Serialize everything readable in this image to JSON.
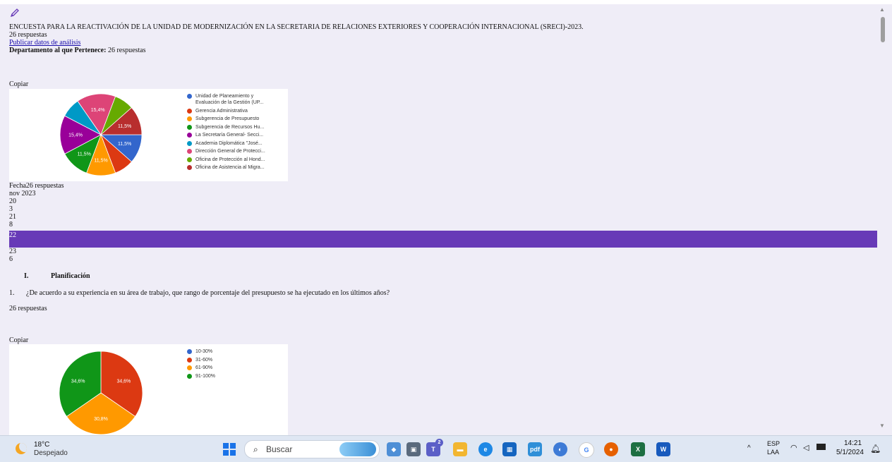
{
  "survey": {
    "title": "ENCUESTA PARA LA REACTIVACIÓN DE LA UNIDAD DE MODERNIZACIÓN EN LA SECRETARIA DE RELACIONES EXTERIORES Y COOPERACIÓN INTERNACIONAL (SRECI)-2023.",
    "responses": "26 respuestas",
    "publish_link": "Publicar datos de análisis"
  },
  "q_department": {
    "label": "Departamento al que Pertenece:",
    "responses": "26 respuestas",
    "copy": "Copiar"
  },
  "q_date": {
    "label": "Fecha",
    "responses": "26 respuestas",
    "month": "nov 2023",
    "values": [
      "20",
      "3",
      "21",
      "8",
      "22",
      "23",
      "6"
    ]
  },
  "section": {
    "number": "I.",
    "title": "Planificación"
  },
  "q_budget": {
    "number": "1.",
    "text": "¿De acuerdo a su experiencia en su área de trabajo, que rango de porcentaje del presupuesto se ha ejecutado en los últimos años?",
    "responses": "26 respuestas",
    "copy": "Copiar"
  },
  "chart_data": [
    {
      "type": "pie",
      "title": "",
      "categories": [
        "Unidad de Planeamiento y Evaluación de la Gestión (UP...",
        "Gerencia Administrativa",
        "Subgerencia de Presupuesto",
        "Subgerencia de Recursos Hu...",
        "La Secretaría General- Secci...",
        "Academia Diplomática \"José...",
        "Dirección General de Protecci...",
        "Oficina de Protección al Hond...",
        "Oficina de Asistencia al Migra..."
      ],
      "legend_lines": [
        [
          "Unidad de Planeamiento y",
          "Evaluación de la Gestión (UP..."
        ],
        [
          "Gerencia Administrativa"
        ],
        [
          "Subgerencia de Presupuesto"
        ],
        [
          "Subgerencia de Recursos Hu..."
        ],
        [
          "La Secretaría General- Secci..."
        ],
        [
          "Academia Diplomática \"José..."
        ],
        [
          "Dirección General de Protecci..."
        ],
        [
          "Oficina de Protección al Hond..."
        ],
        [
          "Oficina de Asistencia al Migra..."
        ]
      ],
      "values": [
        11.5,
        7.7,
        11.5,
        11.5,
        15.4,
        7.7,
        15.4,
        7.7,
        11.5
      ],
      "data_labels": [
        "11,5%",
        "",
        "11,5%",
        "11,5%",
        "15,4%",
        "",
        "15,4%",
        "",
        "11,5%"
      ],
      "colors": [
        "#3366cc",
        "#dc3912",
        "#ff9900",
        "#109618",
        "#990099",
        "#0099c6",
        "#dd4477",
        "#66aa00",
        "#b82e2e"
      ],
      "legend_position": "right"
    },
    {
      "type": "pie",
      "title": "",
      "categories": [
        "10-30%",
        "31-60%",
        "61-90%",
        "91-100%"
      ],
      "legend_lines": [
        [
          "10-30%"
        ],
        [
          "31-60%"
        ],
        [
          "61-90%"
        ],
        [
          "91-100%"
        ]
      ],
      "values": [
        0,
        34.6,
        30.8,
        34.6
      ],
      "data_labels": [
        "",
        "34,6%",
        "30,8%",
        "34,6%"
      ],
      "colors": [
        "#3366cc",
        "#dc3912",
        "#ff9900",
        "#109618"
      ],
      "legend_position": "right"
    }
  ],
  "taskbar": {
    "weather_temp": "18°C",
    "weather_condition": "Despejado",
    "search_placeholder": "Buscar",
    "language": "ESP",
    "layout": "LAA",
    "time": "14:21",
    "date": "5/1/2024",
    "teams_badge": "2"
  }
}
